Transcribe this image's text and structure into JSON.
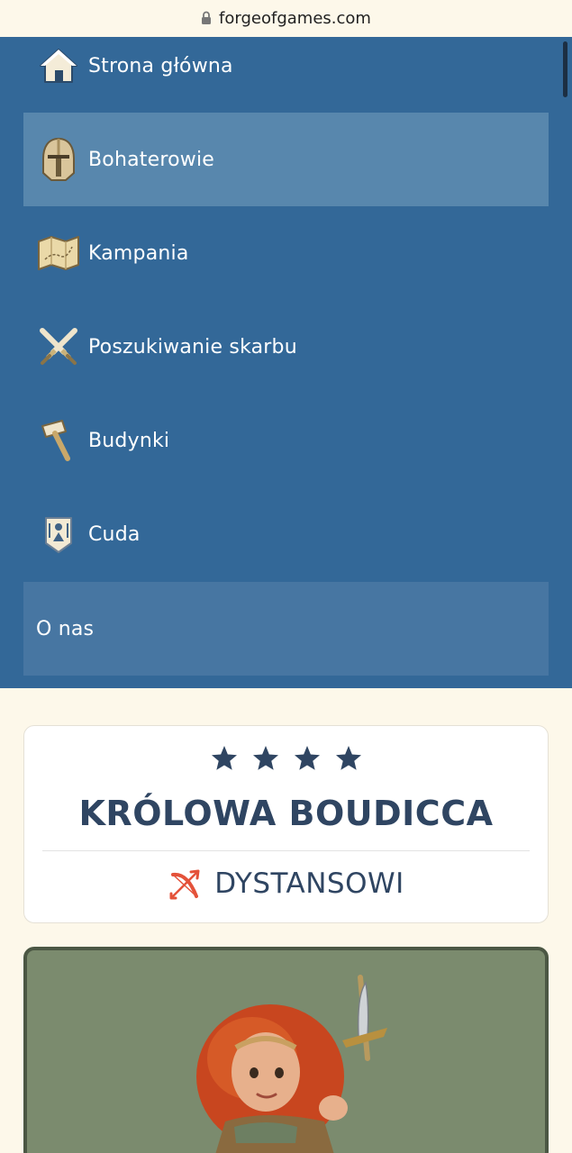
{
  "browser": {
    "url": "forgeofgames.com"
  },
  "menu": {
    "items": [
      {
        "label": "Strona główna",
        "icon": "home-icon"
      },
      {
        "label": "Bohaterowie",
        "icon": "helmet-icon",
        "active": true
      },
      {
        "label": "Kampania",
        "icon": "map-icon"
      },
      {
        "label": "Poszukiwanie skarbu",
        "icon": "crossed-swords-icon"
      },
      {
        "label": "Budynki",
        "icon": "hammer-icon"
      },
      {
        "label": "Cuda",
        "icon": "wonder-icon"
      },
      {
        "label": "O nas"
      }
    ]
  },
  "hero": {
    "stars": 4,
    "name": "KRÓLOWA BOUDICCA",
    "class_label": "DYSTANSOWI",
    "class_icon": "bow-icon"
  },
  "colors": {
    "menu_bg": "#336898",
    "menu_active": "#5887ad",
    "text_dark": "#2f4562",
    "page_bg": "#fdf8ea",
    "portrait_bg": "#7b8b6e",
    "bow_red": "#e4523a"
  }
}
